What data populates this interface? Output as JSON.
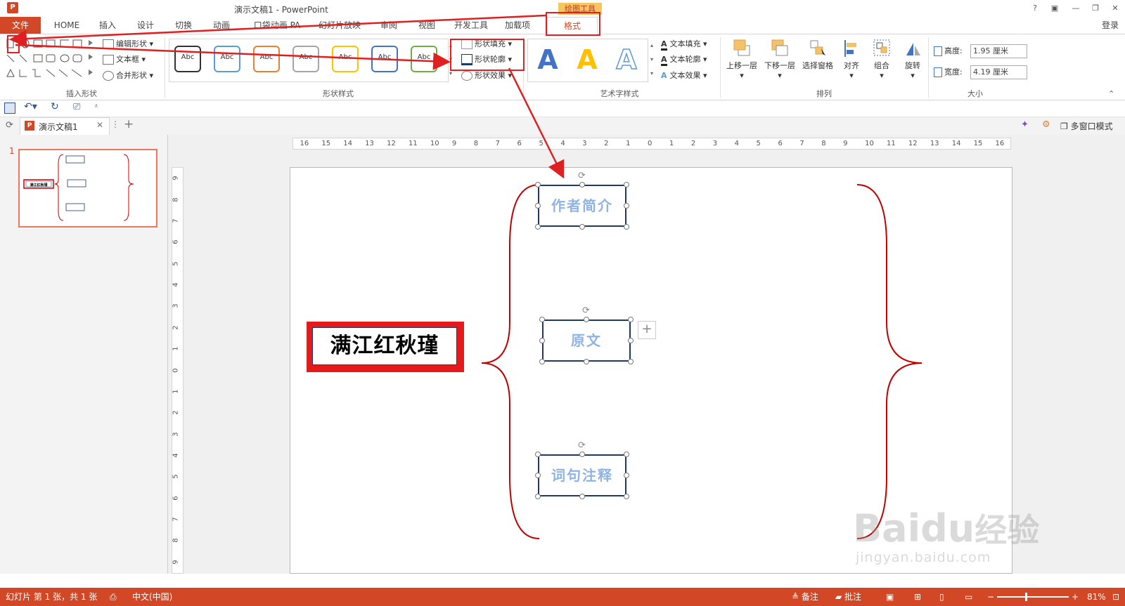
{
  "window": {
    "title": "演示文稿1 - PowerPoint",
    "context_tab_group": "绘图工具",
    "controls": [
      "?",
      "▣",
      "—",
      "❐",
      "✕"
    ],
    "login": "登录"
  },
  "tabs": [
    "文件",
    "HOME",
    "插入",
    "设计",
    "切换",
    "动画",
    "口袋动画 PA",
    "幻灯片放映",
    "审阅",
    "视图",
    "开发工具",
    "加载项",
    "格式"
  ],
  "ribbon": {
    "insert_shapes": {
      "label": "插入形状",
      "edit_shape": "编辑形状",
      "text_box": "文本框",
      "merge_shapes": "合并形状"
    },
    "shape_styles": {
      "label": "形状样式",
      "presets": [
        {
          "text": "Abc",
          "color": "#333333"
        },
        {
          "text": "Abc",
          "color": "#5b9bd5"
        },
        {
          "text": "Abc",
          "color": "#ed7d31"
        },
        {
          "text": "Abc",
          "color": "#a5a5a5"
        },
        {
          "text": "Abc",
          "color": "#ffc000"
        },
        {
          "text": "Abc",
          "color": "#4472c4"
        },
        {
          "text": "Abc",
          "color": "#70ad47"
        }
      ],
      "shape_fill": "形状填充",
      "shape_outline": "形状轮廓",
      "shape_effects": "形状效果"
    },
    "wordart_styles": {
      "label": "艺术字样式",
      "letters": [
        "A",
        "A",
        "A"
      ],
      "text_fill": "文本填充",
      "text_outline": "文本轮廓",
      "text_effects": "文本效果"
    },
    "arrange": {
      "label": "排列",
      "bring_forward": "上移一层",
      "send_backward": "下移一层",
      "selection_pane": "选择窗格",
      "align": "对齐",
      "group": "组合",
      "rotate": "旋转"
    },
    "size": {
      "label": "大小",
      "height_label": "高度:",
      "height_value": "1.95 厘米",
      "width_label": "宽度:",
      "width_value": "4.19 厘米"
    }
  },
  "doc_tabs": {
    "doc_name": "演示文稿1",
    "multi_window": "多窗口模式"
  },
  "ruler": {
    "h_ticks": [
      "16",
      "15",
      "14",
      "13",
      "12",
      "11",
      "10",
      "9",
      "8",
      "7",
      "6",
      "5",
      "4",
      "3",
      "2",
      "1",
      "0",
      "1",
      "2",
      "3",
      "4",
      "5",
      "6",
      "7",
      "8",
      "9",
      "10",
      "11",
      "12",
      "13",
      "14",
      "15",
      "16"
    ],
    "v_ticks": [
      "9",
      "8",
      "7",
      "6",
      "5",
      "4",
      "3",
      "2",
      "1",
      "0",
      "1",
      "2",
      "3",
      "4",
      "5",
      "6",
      "7",
      "8",
      "9"
    ]
  },
  "thumbnail": {
    "number": "1"
  },
  "slide": {
    "main_title": "满江红秋瑾",
    "boxes": [
      "作者简介",
      "原文",
      "词句注释"
    ]
  },
  "status": {
    "slide_info": "幻灯片 第 1 张，共 1 张",
    "language": "中文(中国)",
    "notes": "备注",
    "comments": "批注",
    "zoom": "81%"
  },
  "watermark": {
    "brand": "Bai",
    "brand2": "du",
    "cn": "经验",
    "url": "jingyan.baidu.com"
  },
  "colors": {
    "accent": "#d24726",
    "annotation_red": "#e02020",
    "box_border": "#1f3864",
    "box_text": "#8fb4e3",
    "brace": "#c00000"
  }
}
